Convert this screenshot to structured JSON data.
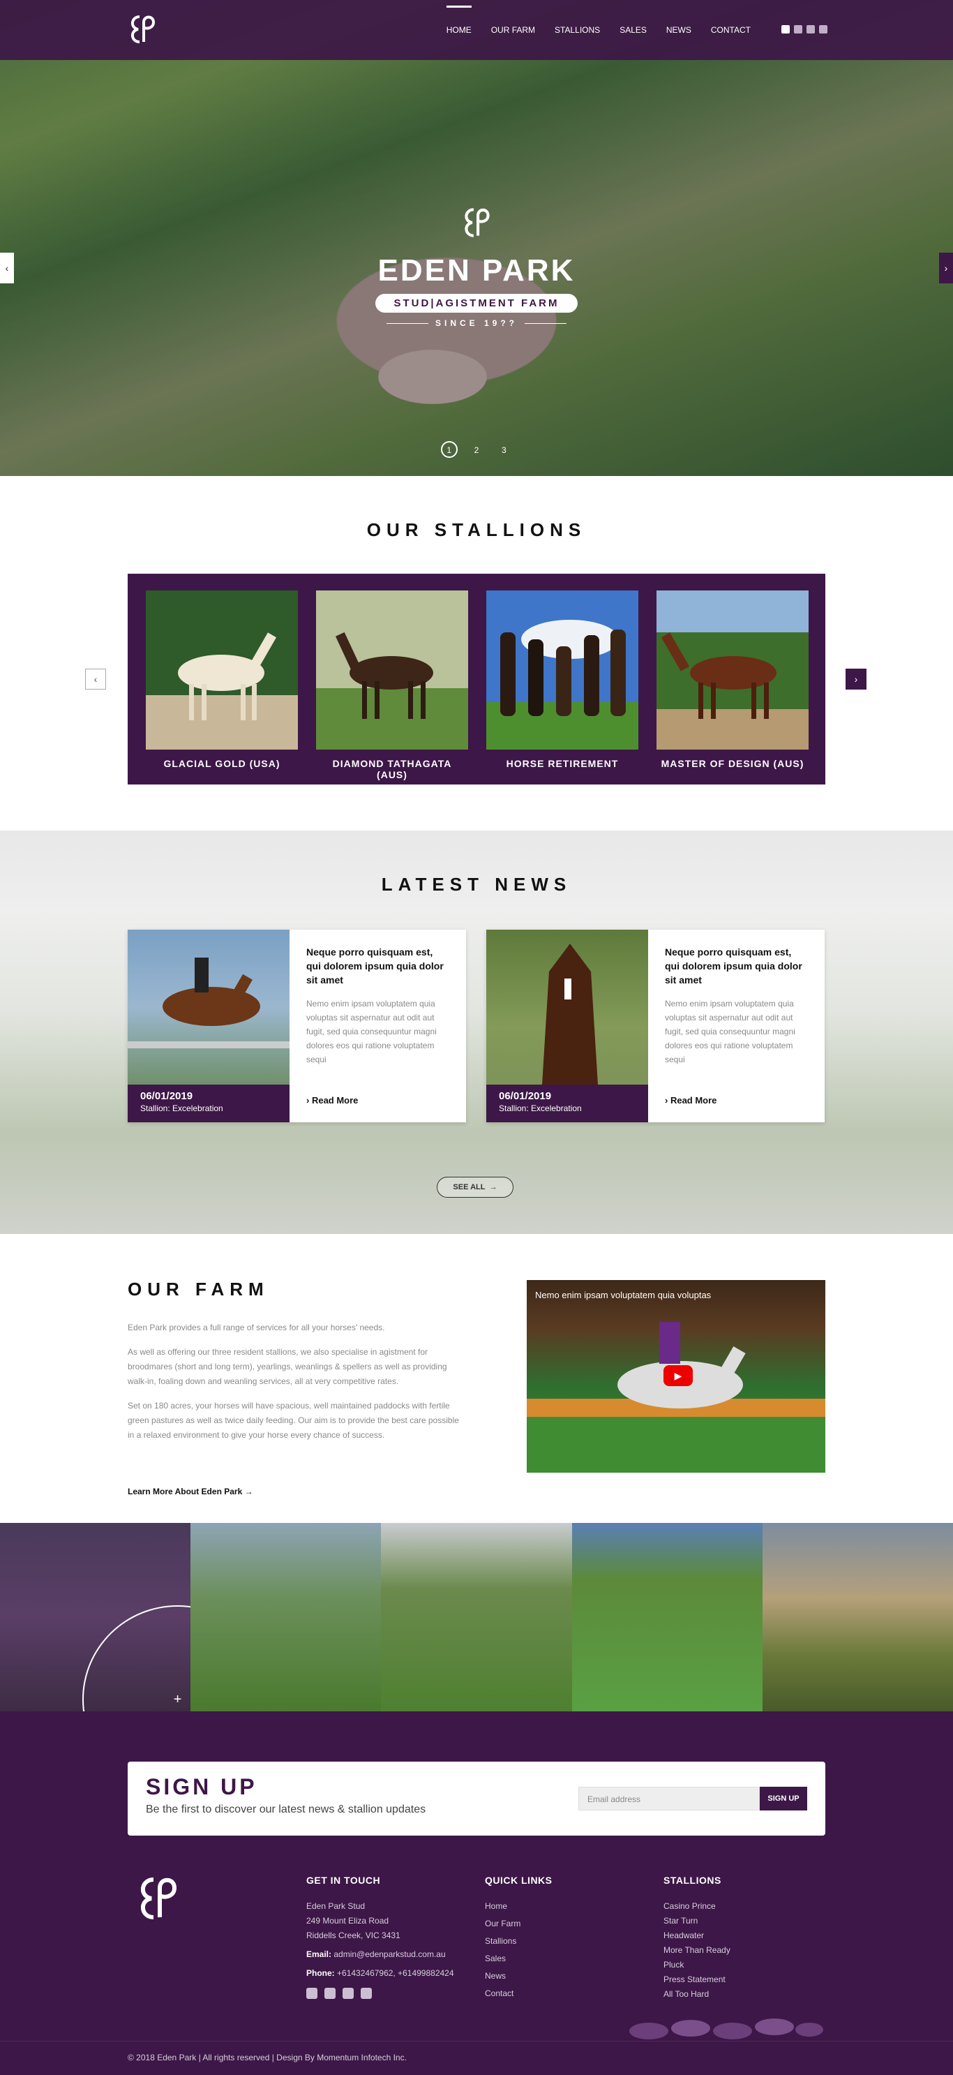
{
  "brand": {
    "name": "EDEN PARK",
    "tagline": "STUD|AGISTMENT FARM",
    "since": "SINCE 19??"
  },
  "nav": {
    "items": [
      "HOME",
      "OUR FARM",
      "STALLIONS",
      "SALES",
      "NEWS",
      "CONTACT"
    ],
    "active_index": 0
  },
  "hero": {
    "slides": [
      "1",
      "2",
      "3"
    ],
    "active_slide": 1
  },
  "stallions": {
    "title": "OUR STALLIONS",
    "items": [
      {
        "name": "GLACIAL GOLD (USA)"
      },
      {
        "name": "DIAMOND TATHAGATA (AUS)"
      },
      {
        "name": "HORSE RETIREMENT"
      },
      {
        "name": "MASTER OF DESIGN (AUS)"
      }
    ]
  },
  "news": {
    "title": "LATEST NEWS",
    "see_all": "SEE ALL",
    "items": [
      {
        "date": "06/01/2019",
        "stallion": "Stallion: Excelebration",
        "heading": "Neque porro quisquam est, qui dolorem ipsum quia dolor sit amet",
        "body": "Nemo enim ipsam voluptatem quia voluptas sit aspernatur aut odit aut fugit, sed quia consequuntur magni dolores eos qui ratione voluptatem sequi",
        "read_more": "Read More"
      },
      {
        "date": "06/01/2019",
        "stallion": "Stallion: Excelebration",
        "heading": "Neque porro quisquam est, qui dolorem ipsum quia dolor sit amet",
        "body": "Nemo enim ipsam voluptatem quia voluptas sit aspernatur aut odit aut fugit, sed quia consequuntur magni dolores eos qui ratione voluptatem sequi",
        "read_more": "Read More"
      }
    ]
  },
  "farm": {
    "title": "OUR FARM",
    "paragraphs": [
      "Eden Park provides a full range of services for all your horses' needs.",
      "As well as offering our three resident stallions, we also specialise in agistment for broodmares (short and long term), yearlings, weanlings & spellers as well as providing walk-in, foaling down and weanling services, all at very competitive rates.",
      "Set on 180 acres, your horses will have spacious, well maintained paddocks with fertile green pastures as well as twice daily feeding. Our aim is to provide the best care possible in a relaxed environment to give your horse every chance of success."
    ],
    "link": "Learn More About Eden Park",
    "video_title": "Nemo enim ipsam voluptatem quia voluptas"
  },
  "signup": {
    "title": "SIGN UP",
    "subtitle": "Be the first to discover our latest news & stallion updates",
    "placeholder": "Email address",
    "button": "SIGN UP"
  },
  "footer": {
    "contact": {
      "title": "GET IN TOUCH",
      "lines": [
        "Eden Park Stud",
        "249 Mount Eliza Road",
        "Riddells Creek, VIC 3431"
      ],
      "email_label": "Email:",
      "email": "admin@edenparkstud.com.au",
      "phone_label": "Phone:",
      "phone": "+61432467962, +61499882424"
    },
    "quick_links": {
      "title": "QUICK LINKS",
      "items": [
        "Home",
        "Our Farm",
        "Stallions",
        "Sales",
        "News",
        "Contact"
      ]
    },
    "stallions": {
      "title": "STALLIONS",
      "items": [
        "Casino Prince",
        "Star Turn",
        "Headwater",
        "More Than Ready",
        "Pluck",
        "Press Statement",
        "All Too Hard"
      ]
    },
    "copyright": "© 2018 Eden Park | All rights reserved | Design By Momentum Infotech Inc."
  }
}
